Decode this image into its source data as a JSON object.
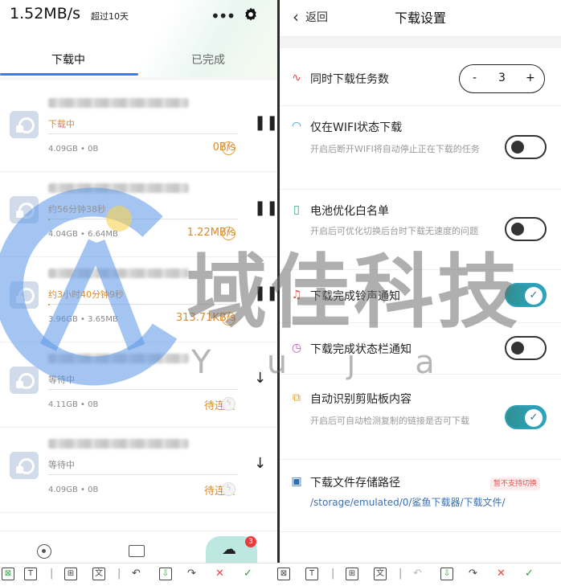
{
  "left": {
    "speed": "1.52MB/s",
    "speed_sub": "超过10天",
    "tabs": [
      "下载中",
      "已完成"
    ],
    "items": [
      {
        "status": "下载中",
        "status_color": "orange",
        "size": "4.09GB • 0B",
        "rate": "0B/s",
        "action": "pause"
      },
      {
        "status": "约56分钟38秒",
        "status_color": "orange",
        "size": "4.04GB • 6.64MB",
        "rate": "1.22MB/s",
        "action": "pause"
      },
      {
        "status": "约3小时40分钟9秒",
        "status_color": "orange",
        "size": "3.96GB • 3.65MB",
        "rate": "313.71KB/s",
        "action": "pause"
      },
      {
        "status": "等待中",
        "status_color": "grey",
        "size": "4.11GB • 0B",
        "rate": "待连接",
        "action": "download"
      },
      {
        "status": "等待中",
        "status_color": "grey",
        "size": "4.09GB • 0B",
        "rate": "待连接",
        "action": "download"
      }
    ],
    "badge_count": "3"
  },
  "right": {
    "back_label": "返回",
    "title": "下载设置",
    "concurrent": {
      "label": "同时下载任务数",
      "minus": "-",
      "value": "3",
      "plus": "+"
    },
    "wifi": {
      "label": "仅在WIFI状态下载",
      "desc": "开启后断开WIFI将自动停止正在下载的任务",
      "on": false
    },
    "battery": {
      "label": "电池优化白名单",
      "desc": "开启后可优化切换后台时下载无速度的问题",
      "on": false
    },
    "ringtone": {
      "label": "下载完成铃声通知",
      "on": true
    },
    "statusbar": {
      "label": "下载完成状态栏通知",
      "on": false
    },
    "clipboard": {
      "label": "自动识别剪贴板内容",
      "desc": "开启后可自动检测复制的链接是否可下载",
      "on": true
    },
    "storage": {
      "label": "下载文件存储路径",
      "tag": "暂不支持切换",
      "path": "/storage/emulated/0/鲨鱼下载器/下载文件/"
    }
  },
  "watermark": {
    "text": "域佳科技",
    "sub": "Yuja"
  },
  "colors": {
    "accent": "#2f7ff6",
    "orange": "#d98a2b",
    "toggle_on": "#2ea6c8"
  }
}
